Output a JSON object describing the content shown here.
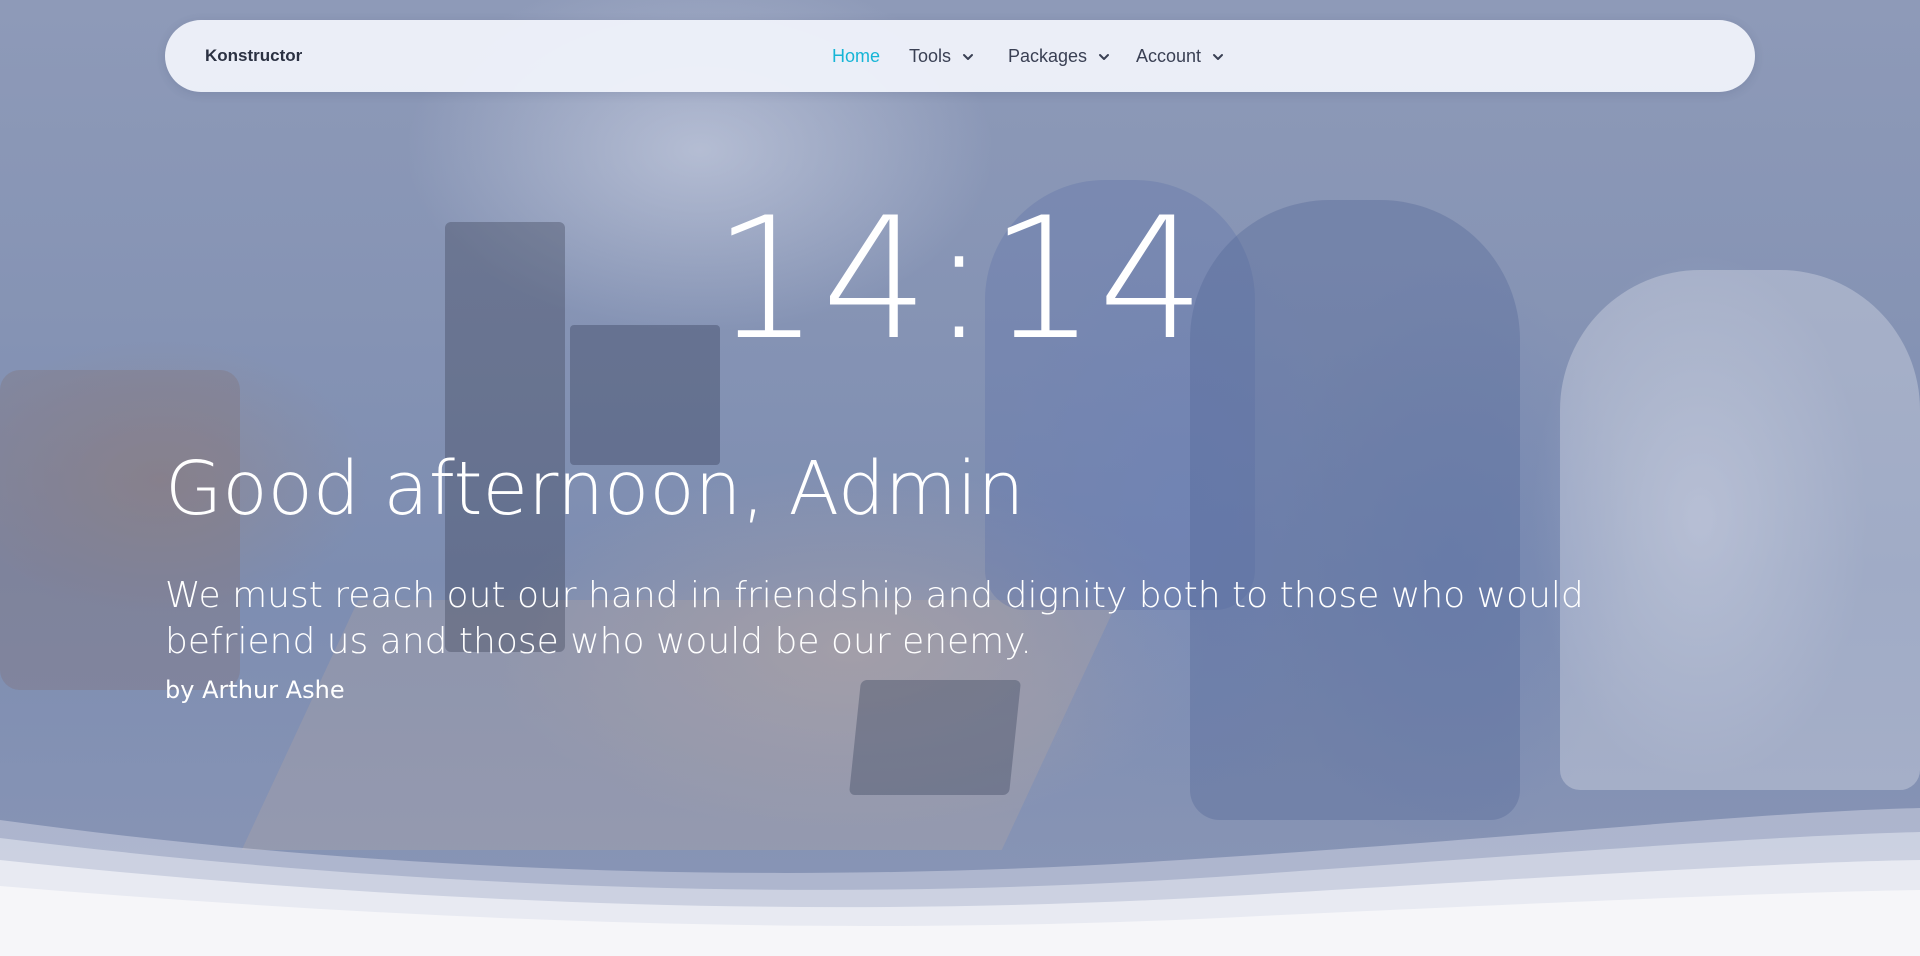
{
  "navbar": {
    "brand": "Konstructor",
    "items": [
      {
        "label": "Home",
        "active": true
      },
      {
        "label": "Tools",
        "dropdown": true
      },
      {
        "label": "Packages",
        "dropdown": true
      },
      {
        "label": "Account",
        "dropdown": true
      }
    ],
    "chevron_icon": "chevron-down-icon",
    "active_color": "#16b5d6"
  },
  "hero": {
    "clock": "14:14",
    "greeting": "Good afternoon, Admin",
    "quote": "We must reach out our hand in friendship and dignity both to those who would befriend us and those who would be our enemy.",
    "author": "by Arthur Ashe"
  }
}
